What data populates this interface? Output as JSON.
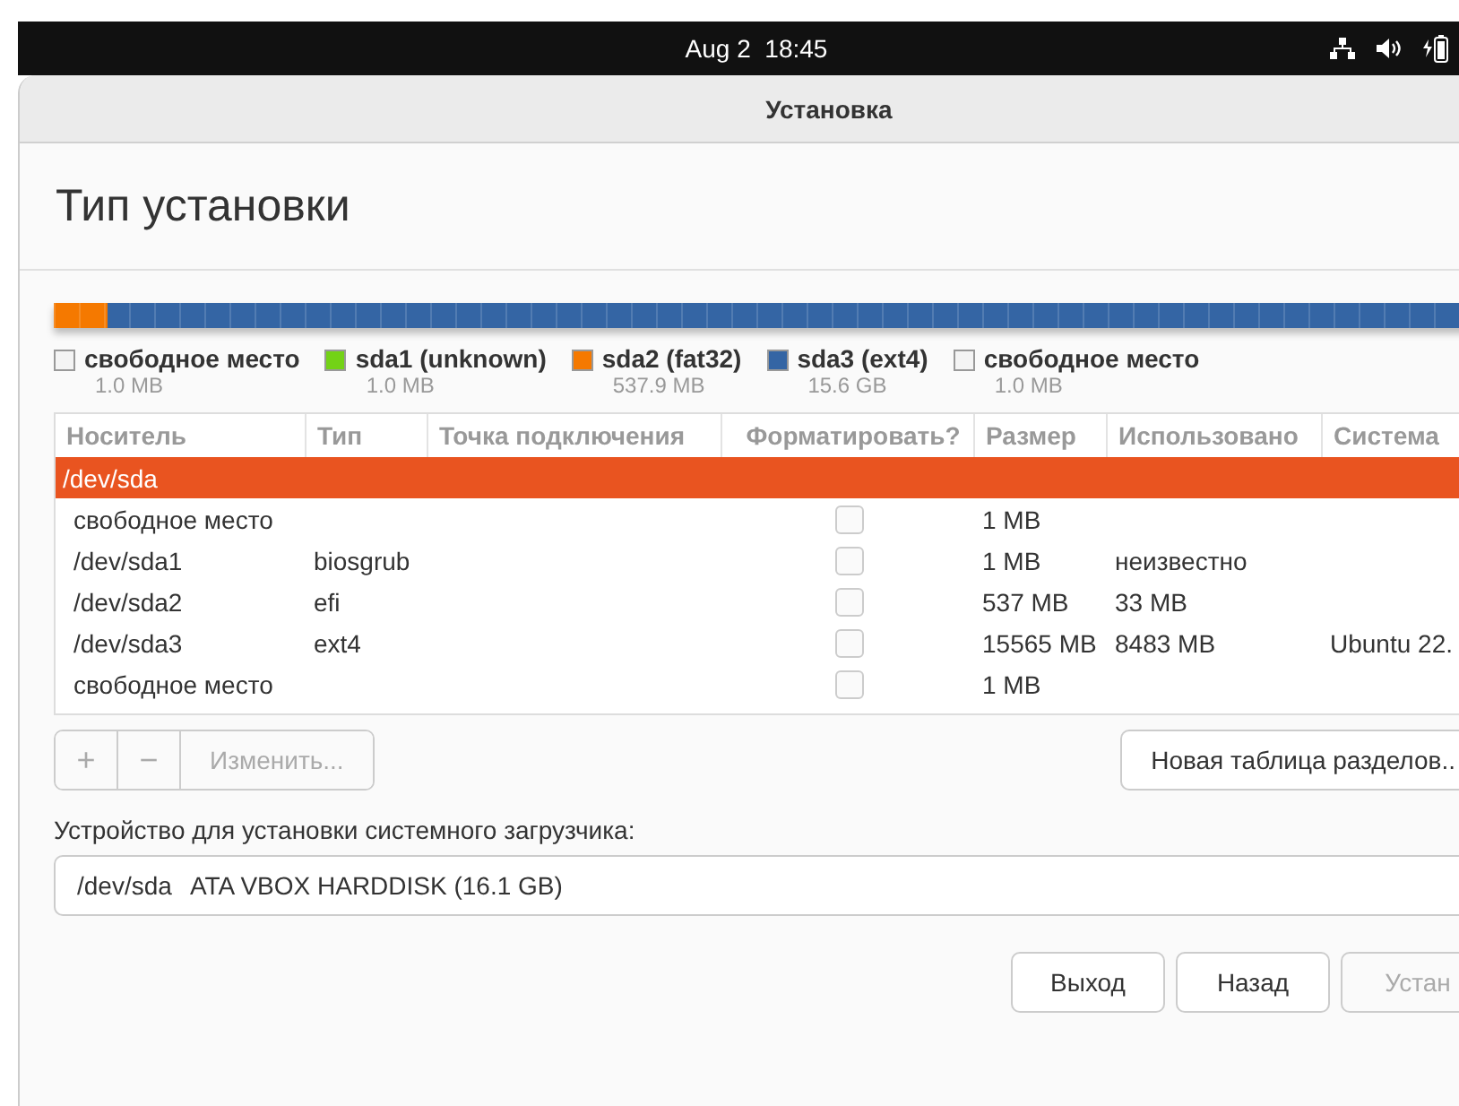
{
  "top_bar": {
    "clock": "Aug 2  18:45"
  },
  "window": {
    "title": "Установка"
  },
  "heading": "Тип установки",
  "partition_legend": [
    {
      "name": "свободное место",
      "size": "1.0 MB",
      "color": "#f4f4f4"
    },
    {
      "name": "sda1 (unknown)",
      "size": "1.0 MB",
      "color": "#73d216"
    },
    {
      "name": "sda2 (fat32)",
      "size": "537.9 MB",
      "color": "#f57900",
      "level": 0.037
    },
    {
      "name": "sda3 (ext4)",
      "size": "15.6 GB",
      "color": "#3465a4",
      "level": 0.96
    },
    {
      "name": "свободное место",
      "size": "1.0 MB",
      "color": "#f4f4f4"
    }
  ],
  "table": {
    "columns": [
      "Носитель",
      "Тип",
      "Точка подключения",
      "Форматировать?",
      "Размер",
      "Использовано",
      "Система"
    ],
    "rows": [
      {
        "kind": "device",
        "selected": true,
        "device": "/dev/sda"
      },
      {
        "kind": "partition",
        "selected": false,
        "device": "свободное место",
        "format": false,
        "size": "1 MB"
      },
      {
        "kind": "partition",
        "selected": false,
        "device": "/dev/sda1",
        "type": "biosgrub",
        "format": false,
        "size": "1 MB",
        "used": "неизвестно"
      },
      {
        "kind": "partition",
        "selected": false,
        "device": "/dev/sda2",
        "type": "efi",
        "format": false,
        "size": "537 MB",
        "used": "33 MB"
      },
      {
        "kind": "partition",
        "selected": false,
        "device": "/dev/sda3",
        "type": "ext4",
        "format": false,
        "size": "15565 MB",
        "used": "8483 MB",
        "system": "Ubuntu 22."
      },
      {
        "kind": "partition",
        "selected": false,
        "device": "свободное место",
        "format": false,
        "size": "1 MB"
      }
    ]
  },
  "table_buttons": [
    {
      "label": "+",
      "disabled": true
    },
    {
      "label": "−",
      "disabled": true
    },
    {
      "label": "Изменить...",
      "disabled": true
    }
  ],
  "new_table_button": "Новая таблица разделов..",
  "bootloader": {
    "label": "Устройство для установки системного загрузчика:",
    "device": "/dev/sda",
    "description": "ATA VBOX HARDDISK (16.1 GB)"
  },
  "buttons": [
    {
      "label": "Выход",
      "disabled": false
    },
    {
      "label": "Назад",
      "disabled": false
    },
    {
      "label": "Устан",
      "disabled": true
    }
  ]
}
